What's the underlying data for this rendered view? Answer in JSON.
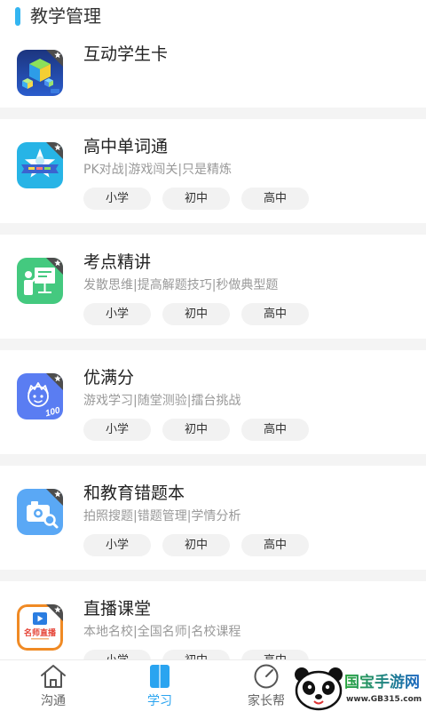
{
  "section": {
    "title": "教学管理",
    "accent_color": "#33b5f1"
  },
  "apps": [
    {
      "title": "互动学生卡",
      "icon": "student-card-icon"
    },
    {
      "title": "高中单词通",
      "subtitle": "PK对战|游戏闯关|只是精炼",
      "icon": "word-star-icon",
      "tags": [
        "小学",
        "初中",
        "高中"
      ]
    },
    {
      "title": "考点精讲",
      "subtitle": "发散思维|提高解题技巧|秒做典型题",
      "icon": "teacher-board-icon",
      "tags": [
        "小学",
        "初中",
        "高中"
      ]
    },
    {
      "title": "优满分",
      "subtitle": "游戏学习|随堂测验|擂台挑战",
      "icon": "cartoon-face-icon",
      "icon_text": "100",
      "tags": [
        "小学",
        "初中",
        "高中"
      ]
    },
    {
      "title": "和教育错题本",
      "subtitle": "拍照搜题|错题管理|学情分析",
      "icon": "camera-search-icon",
      "tags": [
        "小学",
        "初中",
        "高中"
      ]
    },
    {
      "title": "直播课堂",
      "subtitle": "本地名校|全国名师|名校课程",
      "icon": "live-class-icon",
      "icon_text": "名师直播",
      "tags": [
        "小学",
        "初中",
        "高中"
      ]
    }
  ],
  "nav": {
    "active_color": "#2aa4f0",
    "items": [
      {
        "label": "沟通",
        "icon": "home-icon",
        "active": false
      },
      {
        "label": "学习",
        "icon": "book-icon",
        "active": true
      },
      {
        "label": "家长帮",
        "icon": "compass-icon",
        "active": false
      }
    ]
  },
  "watermark": {
    "name": "国宝手游网",
    "url": "www.GB315.com"
  }
}
